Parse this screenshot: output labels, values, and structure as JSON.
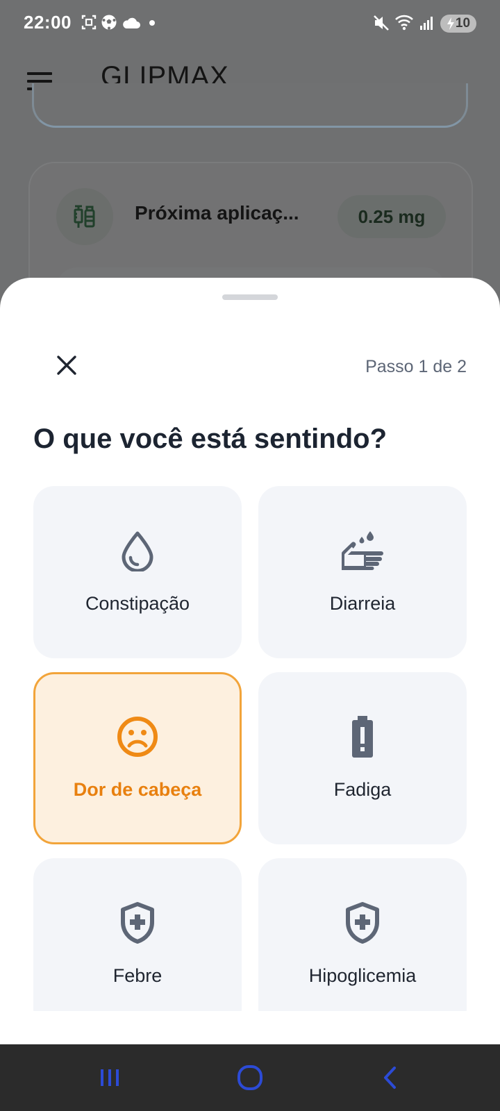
{
  "status_bar": {
    "time": "22:00",
    "battery_level": "10",
    "icons": [
      "screenshot-icon",
      "soccer-ball-icon",
      "cloud-icon",
      "notification-dot-icon",
      "mute-icon",
      "wifi-icon",
      "signal-icon",
      "battery-charging-icon"
    ]
  },
  "app_bar": {
    "title": "GLIPMAX",
    "menu_icon": "hamburger-menu-icon"
  },
  "background": {
    "next_application_label": "Próxima aplicaç...",
    "dose": "0.25 mg",
    "med_icon": "syringe-vial-icon"
  },
  "sheet": {
    "step": "Passo 1 de 2",
    "title": "O que você está sentindo?",
    "close_icon": "close-icon",
    "symptoms": [
      {
        "label": "Constipação",
        "icon": "water-drop-icon",
        "selected": false
      },
      {
        "label": "Diarreia",
        "icon": "hand-wash-icon",
        "selected": false
      },
      {
        "label": "Dor de cabeça",
        "icon": "sad-face-icon",
        "selected": true
      },
      {
        "label": "Fadiga",
        "icon": "battery-alert-icon",
        "selected": false
      },
      {
        "label": "Febre",
        "icon": "shield-plus-icon",
        "selected": false
      },
      {
        "label": "Hipoglicemia",
        "icon": "shield-plus-icon",
        "selected": false
      }
    ]
  },
  "nav_bar": {
    "buttons": [
      "recents-icon",
      "home-icon",
      "back-icon"
    ]
  },
  "colors": {
    "accent": "#f2a43a",
    "accent_text": "#e8800f",
    "tile_bg": "#f3f5f9",
    "selected_bg": "#fdf0df",
    "icon_gray": "#5d6676",
    "nav_icon": "#2c4bd6"
  }
}
